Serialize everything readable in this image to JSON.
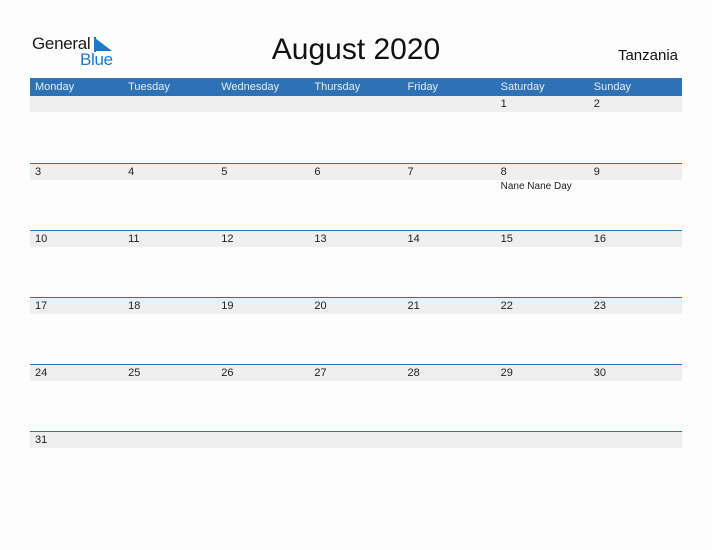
{
  "logo": {
    "line1": "General",
    "line2": "Blue"
  },
  "title": "August 2020",
  "country": "Tanzania",
  "weekdays": [
    "Monday",
    "Tuesday",
    "Wednesday",
    "Thursday",
    "Friday",
    "Saturday",
    "Sunday"
  ],
  "weeks": [
    {
      "days": [
        "",
        "",
        "",
        "",
        "",
        "1",
        "2"
      ],
      "events": [
        "",
        "",
        "",
        "",
        "",
        "",
        ""
      ]
    },
    {
      "days": [
        "3",
        "4",
        "5",
        "6",
        "7",
        "8",
        "9"
      ],
      "events": [
        "",
        "",
        "",
        "",
        "",
        "Nane Nane Day",
        ""
      ]
    },
    {
      "days": [
        "10",
        "11",
        "12",
        "13",
        "14",
        "15",
        "16"
      ],
      "events": [
        "",
        "",
        "",
        "",
        "",
        "",
        ""
      ]
    },
    {
      "days": [
        "17",
        "18",
        "19",
        "20",
        "21",
        "22",
        "23"
      ],
      "events": [
        "",
        "",
        "",
        "",
        "",
        "",
        ""
      ]
    },
    {
      "days": [
        "24",
        "25",
        "26",
        "27",
        "28",
        "29",
        "30"
      ],
      "events": [
        "",
        "",
        "",
        "",
        "",
        "",
        ""
      ]
    },
    {
      "days": [
        "31",
        "",
        "",
        "",
        "",
        "",
        ""
      ],
      "events": [
        "",
        "",
        "",
        "",
        "",
        "",
        ""
      ]
    }
  ],
  "colors": {
    "header_bg": "#2e71b4",
    "strip_bg": "#efefef",
    "logo_blue": "#1d7ac8"
  }
}
